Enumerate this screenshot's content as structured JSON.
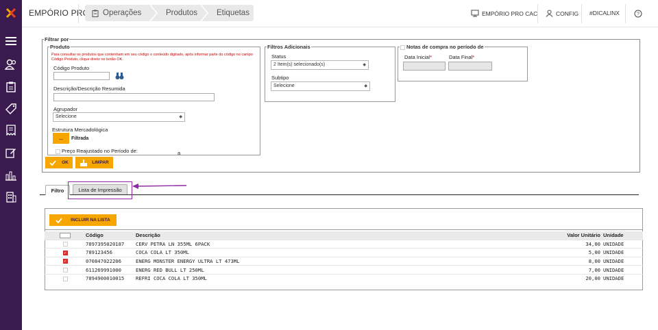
{
  "app": {
    "title": "EMPÓRIO PRO"
  },
  "breadcrumb": [
    {
      "label": "Operações",
      "icon": "clipboard-icon"
    },
    {
      "label": "Produtos"
    },
    {
      "label": "Etiquetas"
    }
  ],
  "topright": {
    "store": "EMPÓRIO PRO CAC",
    "config": "CONFIG",
    "tag": "#DICALINX"
  },
  "filter": {
    "legend": "Filtrar por",
    "produto": {
      "legend": "Produto",
      "hint": "Para consultar os produtos que contenham em seu código o conteúdo digitado, após informar parte do código no campo Código Produto, clique direto no botão OK.",
      "codigo_label": "Código Produto",
      "codigo_value": "",
      "descricao_label": "Descrição/Descrição Resumida",
      "descricao_value": "",
      "agrupador_label": "Agrupador",
      "agrupador_value": "Selecione",
      "estrutura_label": "Estrutura Mercadológica",
      "estrutura_btn": "...",
      "estrutura_status": "Filtrada",
      "preco_label": "Preço Reajustado no Período de:",
      "preco_sep": "a"
    },
    "adicionais": {
      "legend": "Filtros Adicionais",
      "status_label": "Status",
      "status_value": "2 Item(s) selecionado(s)",
      "subtipo_label": "Subtipo",
      "subtipo_value": "Selecione"
    },
    "notas": {
      "legend": "Notas de compra no período de",
      "data_inicial_label": "Data Inicial",
      "data_final_label": "Data Final",
      "required_mark": "*"
    },
    "ok_label": "OK",
    "limpar_label": "LIMPAR"
  },
  "tabs": [
    {
      "label": "Filtro",
      "active": true
    },
    {
      "label": "Lista de Impressão",
      "active": false
    }
  ],
  "list": {
    "add_label": "INCLUIR NA LISTA",
    "columns": [
      "Código",
      "Descrição",
      "Valor Unitário",
      "Unidade"
    ],
    "rows": [
      {
        "checked": false,
        "codigo": "7897395020187",
        "descricao": "CERV PETRA LN 355ML 6PACK",
        "valor": "34,00",
        "unidade": "UNIDADE"
      },
      {
        "checked": true,
        "codigo": "789123456",
        "descricao": "COCA COLA LT 350ML",
        "valor": "5,00",
        "unidade": "UNIDADE"
      },
      {
        "checked": true,
        "codigo": "070847022206",
        "descricao": "ENERG MONSTER ENERGY ULTRA LT 473ML",
        "valor": "8,00",
        "unidade": "UNIDADE"
      },
      {
        "checked": false,
        "codigo": "611269991000",
        "descricao": "ENERG RED BULL LT 250ML",
        "valor": "7,00",
        "unidade": "UNIDADE"
      },
      {
        "checked": false,
        "codigo": "7894900010015",
        "descricao": "REFRI COCA COLA LT 350ML",
        "valor": "20,00",
        "unidade": "UNIDADE"
      }
    ]
  },
  "colors": {
    "sidebar": "#3b1a4f",
    "accent": "#f7a600",
    "annotation": "#8e2aa3",
    "required": "#cc0000"
  }
}
